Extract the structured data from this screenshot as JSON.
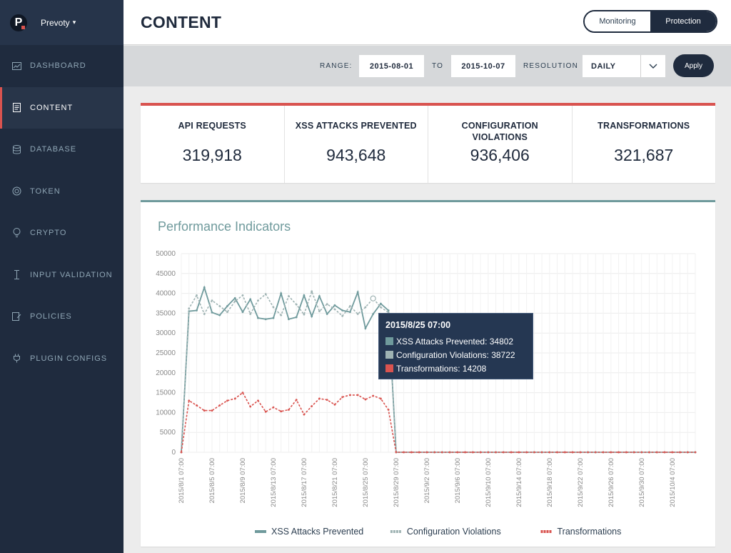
{
  "brand": {
    "logo_letter": "P",
    "name": "Prevoty",
    "caret": "▾"
  },
  "sidebar": {
    "items": [
      {
        "label": "DASHBOARD",
        "icon": "chart-icon",
        "active": false
      },
      {
        "label": "CONTENT",
        "icon": "document-icon",
        "active": true
      },
      {
        "label": "DATABASE",
        "icon": "database-icon",
        "active": false
      },
      {
        "label": "TOKEN",
        "icon": "token-icon",
        "active": false
      },
      {
        "label": "CRYPTO",
        "icon": "lightbulb-icon",
        "active": false
      },
      {
        "label": "INPUT VALIDATION",
        "icon": "input-icon",
        "active": false
      },
      {
        "label": "POLICIES",
        "icon": "policy-icon",
        "active": false
      },
      {
        "label": "PLUGIN CONFIGS",
        "icon": "plugin-icon",
        "active": false
      }
    ]
  },
  "header": {
    "title": "CONTENT",
    "toggle": {
      "monitoring": "Monitoring",
      "protection": "Protection",
      "selected": "Protection"
    }
  },
  "filters": {
    "range_label": "RANGE:",
    "from": "2015-08-01",
    "to_label": "TO",
    "to": "2015-10-07",
    "resolution_label": "RESOLUTION",
    "resolution": "DAILY",
    "apply_label": "Apply"
  },
  "kpis": [
    {
      "label": "API REQUESTS",
      "value": "319,918"
    },
    {
      "label": "XSS ATTACKS PREVENTED",
      "value": "943,648"
    },
    {
      "label": "CONFIGURATION VIOLATIONS",
      "value": "936,406"
    },
    {
      "label": "TRANSFORMATIONS",
      "value": "321,687"
    }
  ],
  "chart_panel": {
    "title": "Performance Indicators"
  },
  "tooltip": {
    "title": "2015/8/25 07:00",
    "rows": [
      {
        "label": "XSS Attacks Prevented: 34802",
        "color": "#6f9a9c"
      },
      {
        "label": "Configuration Violations: 38722",
        "color": "#9fb3b3"
      },
      {
        "label": "Transformations: 14208",
        "color": "#d9534f"
      }
    ]
  },
  "colors": {
    "sidebar": "#1f2b3e",
    "accent_red": "#d9534f",
    "teal": "#6f9a9c",
    "light_teal": "#9fb3b3"
  },
  "chart_data": {
    "type": "line",
    "title": "Performance Indicators",
    "xlabel": "",
    "ylabel": "",
    "ylim": [
      0,
      50000
    ],
    "y_ticks": [
      0,
      5000,
      10000,
      15000,
      20000,
      25000,
      30000,
      35000,
      40000,
      45000,
      50000
    ],
    "x_tick_labels": [
      "2015/8/1 07:00",
      "2015/8/5 07:00",
      "2015/8/9 07:00",
      "2015/8/13 07:00",
      "2015/8/17 07:00",
      "2015/8/21 07:00",
      "2015/8/25 07:00",
      "2015/8/29 07:00",
      "2015/9/2 07:00",
      "2015/9/6 07:00",
      "2015/9/10 07:00",
      "2015/9/14 07:00",
      "2015/9/18 07:00",
      "2015/9/22 07:00",
      "2015/9/26 07:00",
      "2015/9/30 07:00",
      "2015/10/4 07:00"
    ],
    "x_start": "2015-08-01",
    "x_step_days": 1,
    "grid": true,
    "legend_position": "bottom",
    "series": [
      {
        "name": "XSS Attacks Prevented",
        "color": "#6f9a9c",
        "dashed": false,
        "values": [
          0,
          35500,
          35700,
          41500,
          35200,
          34500,
          36800,
          38800,
          35300,
          38500,
          33800,
          33500,
          33800,
          40000,
          33500,
          34000,
          39500,
          34200,
          39300,
          34800,
          37000,
          35700,
          35300,
          40300,
          31200,
          34802,
          37400,
          35700,
          0,
          0,
          0,
          0,
          0,
          0,
          0,
          0,
          0,
          0,
          0,
          0,
          0,
          0,
          0,
          0,
          0,
          0,
          0,
          0,
          0,
          0,
          0,
          0,
          0,
          0,
          0,
          0,
          0,
          0,
          0,
          0,
          0,
          0,
          0,
          0,
          0,
          0,
          0,
          0
        ]
      },
      {
        "name": "Configuration Violations",
        "color": "#9fb3b3",
        "dashed": true,
        "values": [
          0,
          36200,
          39500,
          34800,
          38200,
          36800,
          35300,
          38000,
          39500,
          34800,
          38200,
          39800,
          36500,
          34500,
          39300,
          37200,
          34700,
          40500,
          35500,
          37300,
          36000,
          34300,
          36800,
          34800,
          36500,
          38722,
          36500,
          35200,
          0,
          0,
          0,
          0,
          0,
          0,
          0,
          0,
          0,
          0,
          0,
          0,
          0,
          0,
          0,
          0,
          0,
          0,
          0,
          0,
          0,
          0,
          0,
          0,
          0,
          0,
          0,
          0,
          0,
          0,
          0,
          0,
          0,
          0,
          0,
          0,
          0,
          0,
          0,
          0
        ]
      },
      {
        "name": "Transformations",
        "color": "#d9534f",
        "dashed": true,
        "values": [
          0,
          13000,
          11800,
          10500,
          10500,
          11800,
          13000,
          13500,
          15000,
          11500,
          13000,
          10200,
          11300,
          10300,
          10700,
          13200,
          9500,
          11600,
          13500,
          13200,
          12000,
          13900,
          14400,
          14400,
          13300,
          14208,
          13500,
          10700,
          0,
          0,
          0,
          0,
          0,
          0,
          0,
          0,
          0,
          0,
          0,
          0,
          0,
          0,
          0,
          0,
          0,
          0,
          0,
          0,
          0,
          0,
          0,
          0,
          0,
          0,
          0,
          0,
          0,
          0,
          0,
          0,
          0,
          0,
          0,
          0,
          0,
          0,
          0,
          0
        ]
      }
    ],
    "highlight": {
      "index": 25,
      "label": "2015/8/25 07:00"
    }
  }
}
